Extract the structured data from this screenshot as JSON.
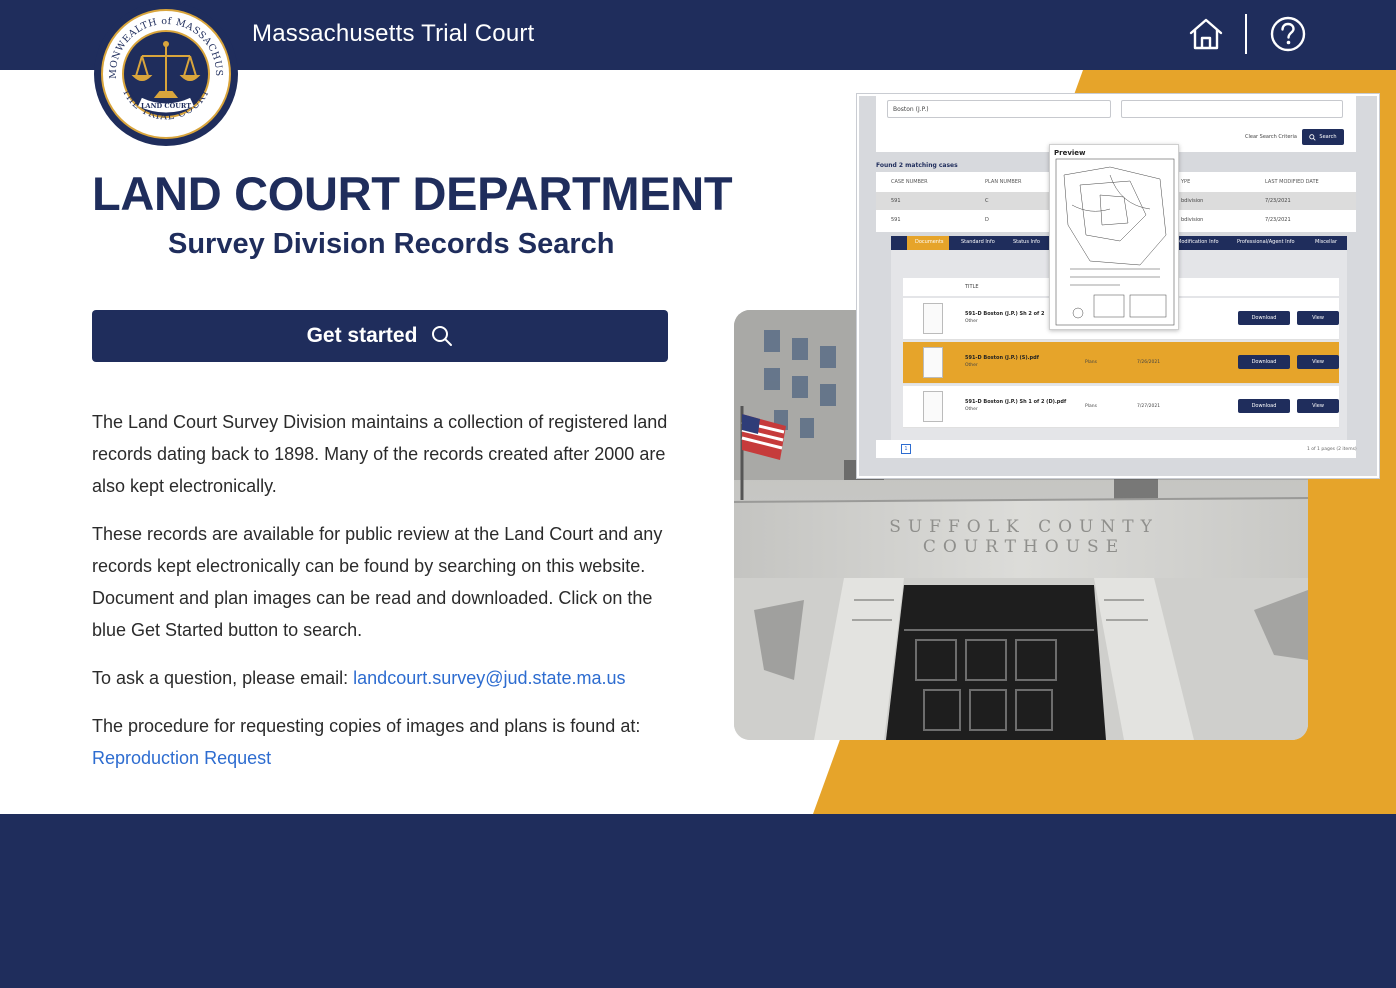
{
  "header": {
    "site_title": "Massachusetts Trial Court",
    "home_icon": "home-icon",
    "help_icon": "help-circle-icon"
  },
  "seal": {
    "ring_text_top": "COMMONWEALTH of MASSACHUSETTS",
    "ring_text_bottom": "THE TRIAL COURT",
    "center_text": "LAND COURT",
    "icon": "scales-of-justice-icon"
  },
  "main": {
    "title": "LAND COURT DEPARTMENT",
    "subtitle": "Survey Division Records Search",
    "get_started_label": "Get started",
    "paragraphs": {
      "p1": "The Land Court Survey Division maintains a collection of registered land records dating back to 1898. Many of the records created after 2000 are also kept electronically.",
      "p2": "These records are available for public review at the Land Court and any records kept electronically can be found by searching on this website. Document and plan images can be read and downloaded. Click on the blue Get Started button to search.",
      "p3_prefix": "To ask a question, please email: ",
      "email": "landcourt.survey@jud.state.ma.us",
      "p4_prefix": "The procedure for requesting copies of images and plans is found at:",
      "reproduction_link": "Reproduction Request"
    }
  },
  "photo": {
    "engraving_line1": "SUFFOLK COUNTY",
    "engraving_line2": "COURTHOUSE"
  },
  "screenshot": {
    "select_value": "Boston (J.P.)",
    "clear_label": "Clear Search Criteria",
    "search_label": "Search",
    "found_text": "Found 2 matching cases",
    "columns": [
      "CASE NUMBER",
      "PLAN NUMBER",
      "YPE",
      "LAST MODIFIED DATE"
    ],
    "rows": [
      {
        "case": "591",
        "plan": "C",
        "type": "bdivision",
        "date": "7/23/2021"
      },
      {
        "case": "591",
        "plan": "D",
        "type": "bdivision",
        "date": "7/23/2021"
      }
    ],
    "tabs": [
      "Documents",
      "Standard Info",
      "Status Info",
      "Modification Info",
      "Professional/Agent Info",
      "Miscellar"
    ],
    "doc_header": "TITLE",
    "preview_label": "Preview",
    "documents": [
      {
        "title": "591-D Boston (J.P.) Sh 2 of 2",
        "type": "Other",
        "kind": "",
        "date": ""
      },
      {
        "title": "591-D Boston (J.P.) (S).pdf",
        "type": "Other",
        "kind": "Plans",
        "date": "7/26/2021"
      },
      {
        "title": "591-D Boston (J.P.) Sh 1 of 2 (D).pdf",
        "type": "Other",
        "kind": "Plans",
        "date": "7/27/2021"
      }
    ],
    "download_label": "Download",
    "view_label": "View",
    "page_number": "1",
    "pager_info": "1 of 1 pages (2 items)"
  },
  "colors": {
    "navy": "#1f2d5c",
    "gold": "#e6a42a",
    "link": "#2d6cd0"
  }
}
